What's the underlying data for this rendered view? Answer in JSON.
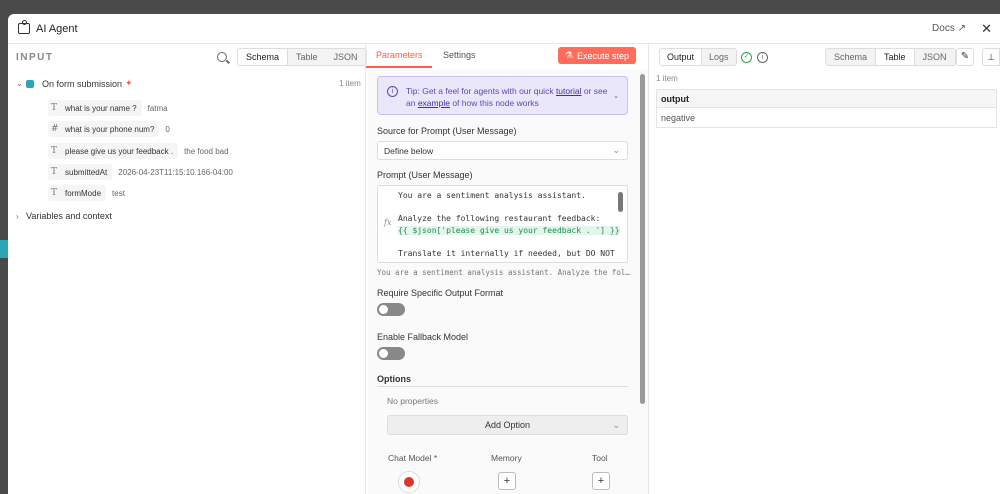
{
  "window": {
    "title": "AI Agent",
    "docs_label": "Docs",
    "close_label": "✕"
  },
  "input_panel": {
    "heading": "INPUT",
    "view_tabs": [
      "Schema",
      "Table",
      "JSON"
    ],
    "trigger": {
      "name": "On form submission",
      "count": "1 item"
    },
    "fields": [
      {
        "type_icon": "T",
        "name": "what is your name ?",
        "value": "fatma"
      },
      {
        "type_icon": "#",
        "name": "what is your phone num?",
        "value": "0"
      },
      {
        "type_icon": "T",
        "name": "please give us your feedback .",
        "value": "the food bad"
      },
      {
        "type_icon": "T",
        "name": "submittedAt",
        "value": "2026-04-23T11:15:10.166-04:00"
      },
      {
        "type_icon": "T",
        "name": "formMode",
        "value": "test"
      }
    ],
    "variables_label": "Variables and context"
  },
  "params_panel": {
    "tabs": [
      "Parameters",
      "Settings"
    ],
    "active_tab": "Parameters",
    "execute_label": "Execute step",
    "tip": {
      "prefix": "Tip: Get a feel for agents with our quick ",
      "tutorial_link": "tutorial",
      "middle": " or see an ",
      "example_link": "example",
      "suffix": " of how this node works"
    },
    "source_label": "Source for Prompt (User Message)",
    "source_value": "Define below",
    "prompt_label": "Prompt (User Message)",
    "prompt_line1": "You are a sentiment analysis assistant.",
    "prompt_line2": "Analyze the following restaurant feedback:",
    "prompt_expr": "{{ $json['please give us your feedback . '] }}",
    "prompt_line4": "Translate it internally if needed, but DO NOT",
    "prompt_preview": "You are a sentiment analysis assistant. Analyze the fol…",
    "require_format_label": "Require Specific Output Format",
    "require_format_on": false,
    "fallback_label": "Enable Fallback Model",
    "fallback_on": false,
    "options_label": "Options",
    "no_properties": "No properties",
    "add_option_label": "Add Option",
    "sub_nodes": [
      "Chat Model *",
      "Memory",
      "Tool"
    ]
  },
  "output_panel": {
    "tabs": [
      "Output",
      "Logs"
    ],
    "view_tabs": [
      "Schema",
      "Table",
      "JSON"
    ],
    "active_view": "Table",
    "items_count": "1 item",
    "table": {
      "header": "output",
      "rows": [
        "negative"
      ]
    }
  },
  "colors": {
    "accent": "#ff6d5a",
    "tip_bg": "#ebe7fb",
    "success": "#2aa44f"
  }
}
